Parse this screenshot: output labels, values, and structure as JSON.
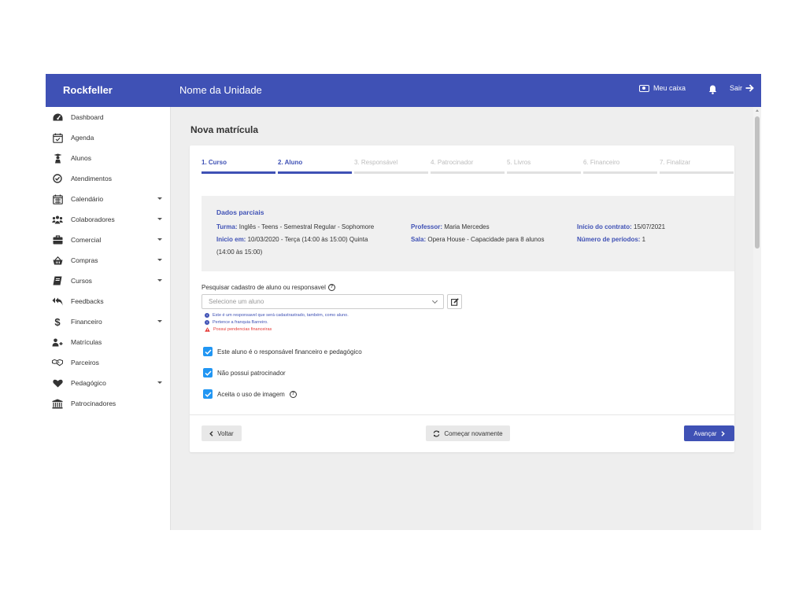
{
  "app": {
    "brand": "Rockfeller",
    "unit_title": "Nome da Unidade",
    "cash_label": "Meu caixa",
    "logout_label": "Sair",
    "accent_color": "#3f51b5"
  },
  "sidebar": {
    "items": [
      {
        "label": "Dashboard",
        "icon": "dashboard-icon",
        "expandable": false
      },
      {
        "label": "Agenda",
        "icon": "calendar-check-icon",
        "expandable": false
      },
      {
        "label": "Alunos",
        "icon": "student-icon",
        "expandable": false
      },
      {
        "label": "Atendimentos",
        "icon": "check-circle-icon",
        "expandable": false
      },
      {
        "label": "Calendário",
        "icon": "calendar-icon",
        "expandable": true
      },
      {
        "label": "Colaboradores",
        "icon": "users-icon",
        "expandable": true
      },
      {
        "label": "Comercial",
        "icon": "briefcase-icon",
        "expandable": true
      },
      {
        "label": "Compras",
        "icon": "shopping-basket-icon",
        "expandable": true
      },
      {
        "label": "Cursos",
        "icon": "book-icon",
        "expandable": true
      },
      {
        "label": "Feedbacks",
        "icon": "reply-all-icon",
        "expandable": false
      },
      {
        "label": "Financeiro",
        "icon": "dollar-icon",
        "expandable": true
      },
      {
        "label": "Matrículas",
        "icon": "user-plus-icon",
        "expandable": false
      },
      {
        "label": "Parceiros",
        "icon": "handshake-icon",
        "expandable": false
      },
      {
        "label": "Pedagógico",
        "icon": "heart-icon",
        "expandable": true
      },
      {
        "label": "Patrocinadores",
        "icon": "bank-icon",
        "expandable": false
      }
    ]
  },
  "page": {
    "title": "Nova matrícula"
  },
  "stepper": {
    "steps": [
      {
        "label": "1. Curso",
        "active": true
      },
      {
        "label": "2. Aluno",
        "active": true
      },
      {
        "label": "3. Responsável",
        "active": false
      },
      {
        "label": "4. Patrocinador",
        "active": false
      },
      {
        "label": "5. Livros",
        "active": false
      },
      {
        "label": "6. Financeiro",
        "active": false
      },
      {
        "label": "7. Finalizar",
        "active": false
      }
    ]
  },
  "summary": {
    "heading": "Dados parciais",
    "turma_key": "Turma:",
    "turma_value": " Inglês - Teens - Semestral Regular - Sophomore",
    "inicio_key": "Inicio em:",
    "inicio_value": " 10/03/2020 - Terça (14:00 às 15:00) Quinta",
    "inicio_value2": "(14:00 às 15:00)",
    "professor_key": "Professor:",
    "professor_value": " Maria Mercedes",
    "sala_key": "Sala:",
    "sala_value": " Opera House - Capacidade para 8 alunos",
    "contrato_key": "Início do contrato:",
    "contrato_value": " 15/07/2021",
    "periodos_key": "Número de períodos:",
    "periodos_value": " 1"
  },
  "search": {
    "label": "Pesquisar cadastro de aluno ou responsavel",
    "placeholder": "Selecione um aluno"
  },
  "notices": [
    {
      "text": "Este é um responsavel que será cadastrastrado, também, como aluno.",
      "type": "info"
    },
    {
      "text": "Pertence a franquia Barreiro.",
      "type": "info"
    },
    {
      "text": "Possui pendencias financeiras",
      "type": "warning"
    }
  ],
  "checkboxes": [
    {
      "label": "Este aluno é o responsável financeiro e pedagógico",
      "checked": true
    },
    {
      "label": "Não possui patrocinador",
      "checked": true
    },
    {
      "label": "Aceita o uso de imagem",
      "checked": true
    }
  ],
  "buttons": {
    "back": "Voltar",
    "restart": "Começar novamente",
    "next": "Avançar"
  }
}
